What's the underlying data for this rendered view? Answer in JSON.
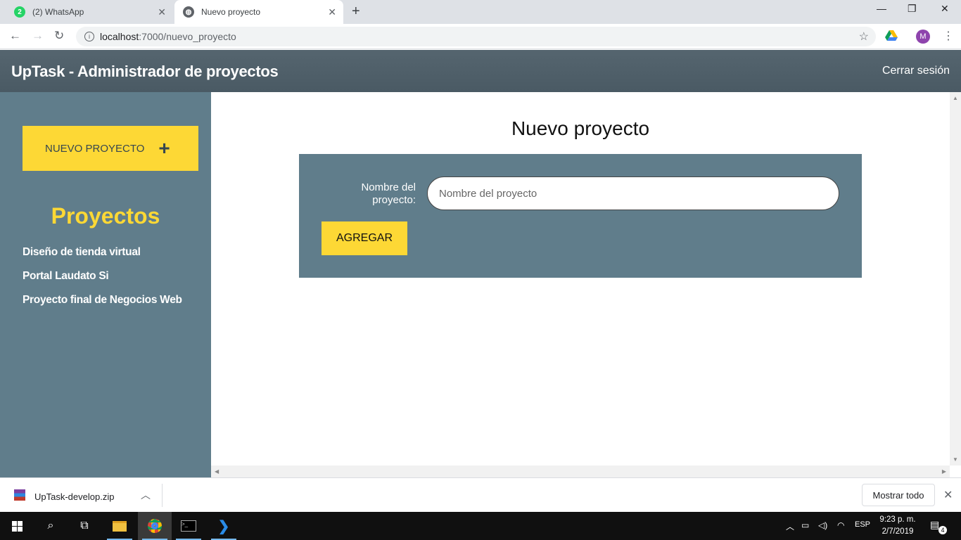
{
  "browser": {
    "tabs": [
      {
        "title": "(2) WhatsApp",
        "badge": "2"
      },
      {
        "title": "Nuevo proyecto"
      }
    ],
    "url_host": "localhost",
    "url_rest": ":7000/nuevo_proyecto",
    "profile_initial": "M"
  },
  "app": {
    "title": "UpTask - Administrador de proyectos",
    "logout_label": "Cerrar sesión"
  },
  "sidebar": {
    "new_project_label": "NUEVO PROYECTO",
    "new_project_icon": "+",
    "projects_heading": "Proyectos",
    "projects": [
      "Diseño de tienda virtual",
      "Portal Laudato Si",
      "Proyecto final de Negocios Web"
    ]
  },
  "main": {
    "heading": "Nuevo proyecto",
    "form": {
      "label": "Nombre del proyecto:",
      "placeholder": "Nombre del proyecto",
      "value": "",
      "submit_label": "AGREGAR"
    }
  },
  "download_bar": {
    "file_name": "UpTask-develop.zip",
    "show_all_label": "Mostrar todo"
  },
  "taskbar": {
    "language": "ESP",
    "time": "9:23 p. m.",
    "date": "2/7/2019",
    "notification_count": "4"
  },
  "colors": {
    "header": "#4f5f69",
    "sidebar": "#607d8b",
    "accent_yellow": "#fdd835",
    "form_panel": "#607d8b"
  }
}
